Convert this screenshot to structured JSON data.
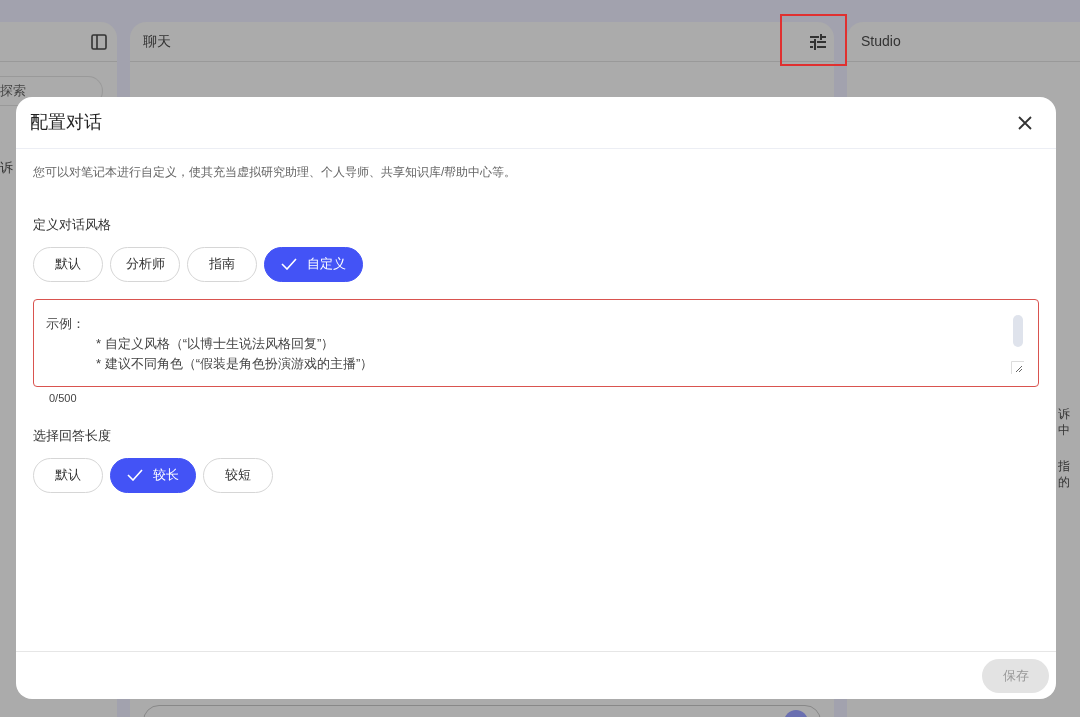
{
  "sidebar": {
    "search_text": "探索",
    "item_text": "诉"
  },
  "chat": {
    "title": "聊天",
    "tune_highlighted": true
  },
  "studio": {
    "title": "Studio",
    "snippets": [
      "诉",
      "中",
      "指",
      "的"
    ]
  },
  "dialog": {
    "title": "配置对话",
    "description": "您可以对笔记本进行自定义，使其充当虚拟研究助理、个人导师、共享知识库/帮助中心等。",
    "style_label": "定义对话风格",
    "style_options": [
      {
        "label": "默认",
        "selected": false
      },
      {
        "label": "分析师",
        "selected": false
      },
      {
        "label": "指南",
        "selected": false
      },
      {
        "label": "自定义",
        "selected": true
      }
    ],
    "prompt": {
      "placeholder_lines": [
        {
          "kind": "heading",
          "text": "示例："
        },
        {
          "kind": "bullet",
          "text": "* 自定义风格（“以博士生说法风格回复”）"
        },
        {
          "kind": "bullet",
          "text": "* 建议不同角色（“假装是角色扮演游戏的主播”）"
        }
      ],
      "invalid": true
    },
    "count": "0/500",
    "length_label": "选择回答长度",
    "length_options": [
      {
        "label": "默认",
        "selected": false
      },
      {
        "label": "较长",
        "selected": true
      },
      {
        "label": "较短",
        "selected": false
      }
    ],
    "save": {
      "label": "保存",
      "disabled": true
    }
  }
}
